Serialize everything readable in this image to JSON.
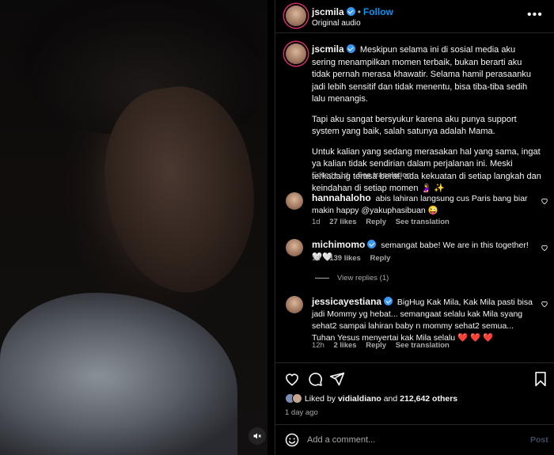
{
  "media": {
    "mute_icon": "speaker-muted-icon"
  },
  "header": {
    "username": "jscmila",
    "follow_label": "Follow",
    "dot": "•",
    "audio_label": "Original audio",
    "more_label": "•••"
  },
  "caption": {
    "username": "jscmila",
    "paragraph1": "Meskipun selama ini di sosial media aku sering menampilkan momen terbaik, bukan berarti aku tidak pernah merasa khawatir. Selama hamil perasaanku jadi lebih sensitif dan tidak menentu, bisa tiba-tiba sedih lalu menangis.",
    "paragraph2": "Tapi aku sangat bersyukur karena aku punya support system yang baik, salah satunya adalah Mama.",
    "paragraph3": "Untuk kalian yang sedang merasakan hal yang sama, ingat ya kalian tidak sendirian dalam perjalanan ini. Meski terkadang terasa berat, ada kekuatan di setiap langkah dan keindahan di setiap momen 🤰 ✨",
    "edited": "Edited • 1d",
    "see_translation": "See translation"
  },
  "comments": [
    {
      "username": "hannahaloho",
      "verified": false,
      "text": "abis lahiran langsung cus Paris bang biar makin happy @yakuphasibuan 😜",
      "time": "1d",
      "likes": "27 likes",
      "reply": "Reply",
      "see_translation": "See translation"
    },
    {
      "username": "michimomo",
      "verified": true,
      "text": "semangat babe! We are in this together! 🤍🤍",
      "time": "1d",
      "likes": "139 likes",
      "reply": "Reply",
      "view_replies": "View replies (1)"
    },
    {
      "username": "jessicayestiana",
      "verified": true,
      "text": "BigHug Kak Mila, Kak Mila pasti bisa jadi Mommy yg hebat... semangaat selalu kak Mila syang sehat2 sampai lahiran baby n mommy sehat2 semua... Tuhan Yesus menyertai kak Mila selalu ❤️ ❤️ ❤️",
      "time": "12h",
      "likes": "2 likes",
      "reply": "Reply",
      "see_translation": "See translation"
    }
  ],
  "likes_summary": {
    "prefix": "Liked by",
    "user": "vidialdiano",
    "and": "and",
    "count": "212,642 others"
  },
  "time_ago": "1 day ago",
  "add_comment": {
    "placeholder": "Add a comment...",
    "post_label": "Post"
  },
  "colors": {
    "link_blue": "#0095f6",
    "verified_blue": "#3897f0",
    "muted_text": "#a8a8a8",
    "heart_red": "#ed4956"
  }
}
